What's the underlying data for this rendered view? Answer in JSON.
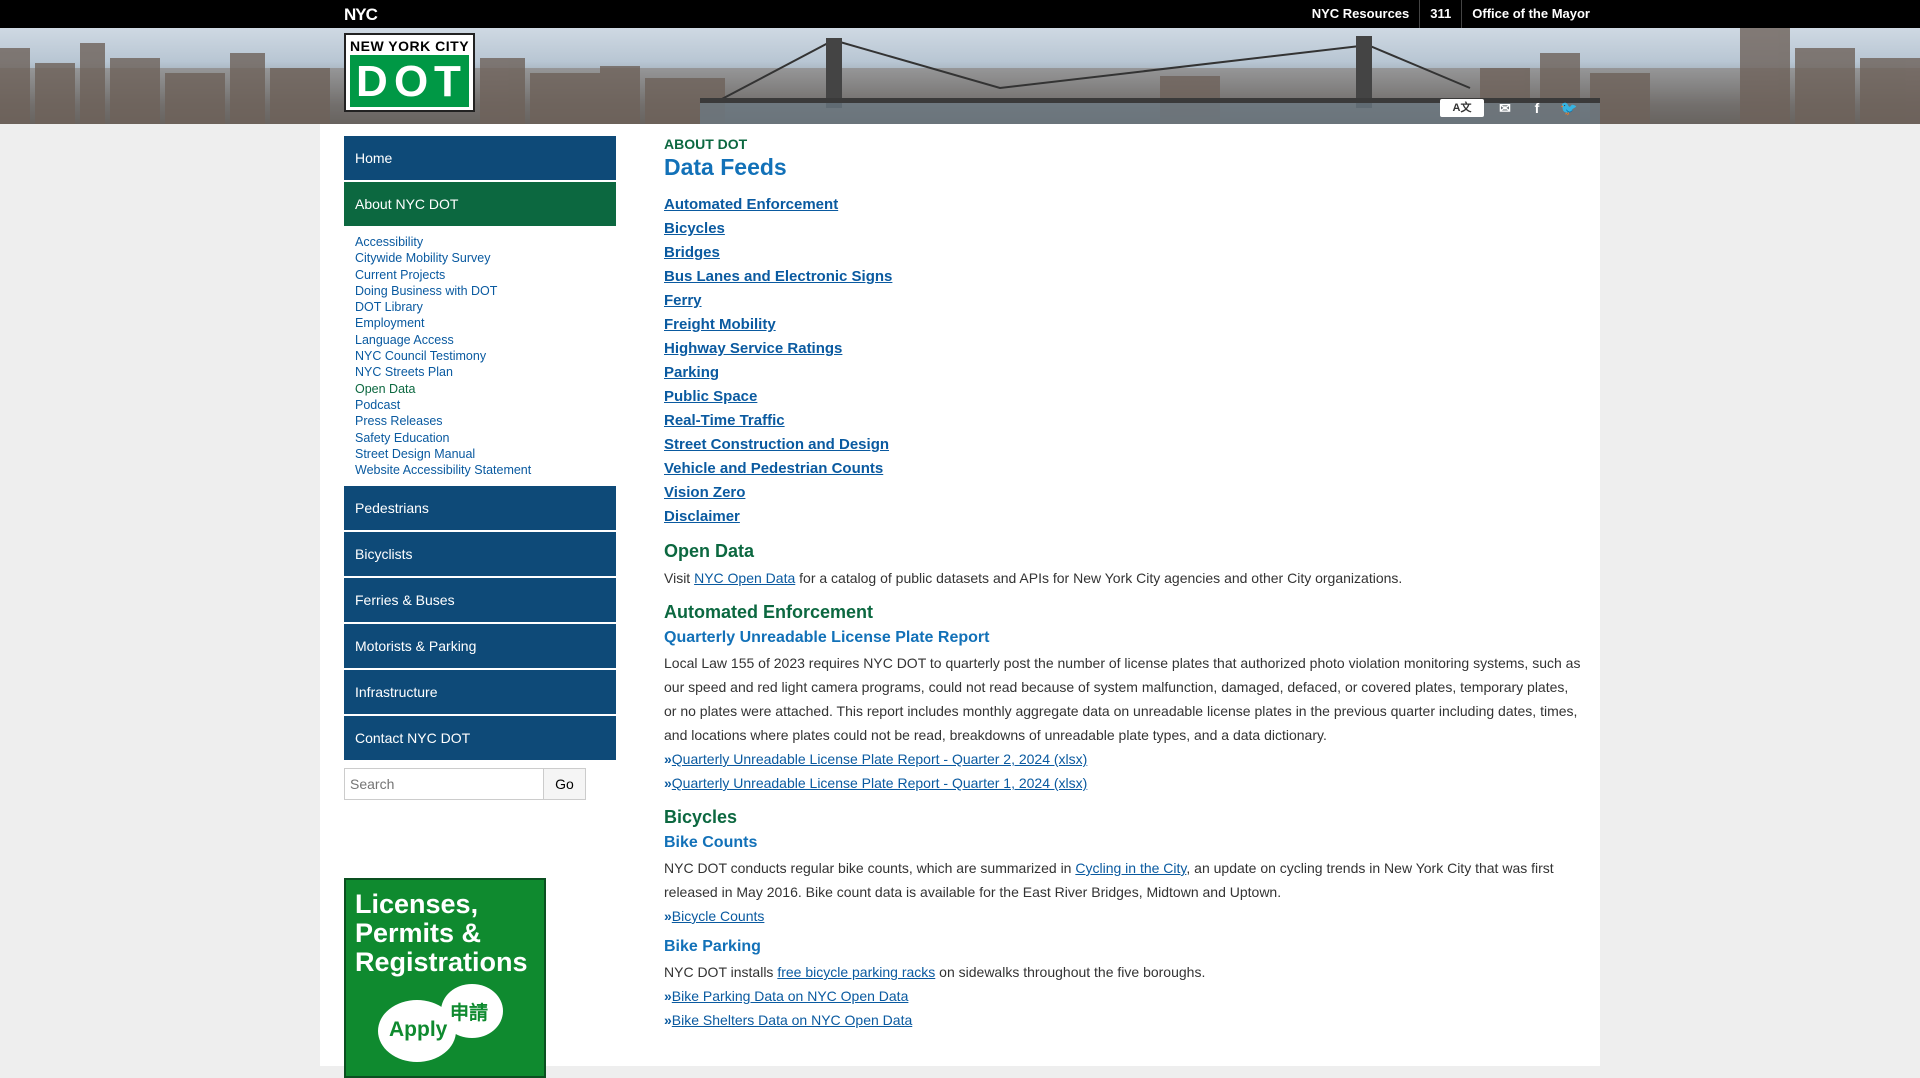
{
  "topbar": {
    "logo": "NYC",
    "links": [
      "NYC Resources",
      "311",
      "Office of the Mayor"
    ]
  },
  "header": {
    "logo_top": "NEW YORK CITY",
    "logo_letters": [
      "D",
      "O",
      "T"
    ]
  },
  "social_icons": [
    "translate-icon",
    "email-icon",
    "facebook-icon",
    "twitter-icon"
  ],
  "sidebar": {
    "nav_top": [
      {
        "label": "Home"
      },
      {
        "label": "About NYC DOT"
      }
    ],
    "subnav": [
      "Accessibility",
      "Citywide Mobility Survey",
      "Current Projects",
      "Doing Business with DOT",
      "DOT Library",
      "Employment",
      "Language Access",
      "NYC Council Testimony",
      "NYC Streets Plan",
      "Open Data",
      "Podcast",
      "Press Releases",
      "Safety Education",
      "Street Design Manual",
      "Website Accessibility Statement"
    ],
    "nav_bottom": [
      {
        "label": "Pedestrians"
      },
      {
        "label": "Bicyclists"
      },
      {
        "label": "Ferries & Buses"
      },
      {
        "label": "Motorists & Parking"
      },
      {
        "label": "Infrastructure"
      },
      {
        "label": "Contact NYC DOT"
      }
    ],
    "search_placeholder": "Search",
    "search_button": "Go",
    "promo": {
      "title_lines": [
        "Licenses,",
        "Permits &",
        "Registrations"
      ],
      "apply": "Apply",
      "apply_cn": "申請"
    }
  },
  "main": {
    "eyebrow": "ABOUT DOT",
    "title": "Data Feeds",
    "feeds": [
      "Automated Enforcement",
      "Bicycles",
      "Bridges",
      "Bus Lanes and Electronic Signs",
      "Ferry",
      "Freight Mobility",
      "Highway Service Ratings",
      "Parking",
      "Public Space",
      "Real-Time Traffic",
      "Street Construction and Design",
      "Vehicle and Pedestrian Counts",
      "Vision Zero",
      "Disclaimer"
    ],
    "open_data": {
      "heading": "Open Data",
      "pre": "Visit ",
      "link": "NYC Open Data",
      "post": " for a catalog of public datasets and APIs for New York City agencies and other City organizations."
    },
    "auto": {
      "heading": "Automated Enforcement",
      "sub": "Quarterly Unreadable License Plate Report",
      "body": "Local Law 155 of 2023 requires NYC DOT to quarterly post the number of license plates that authorized photo violation monitoring systems, such as our speed and red light camera programs, could not read because of system malfunction, damaged, defaced, or covered plates, temporary plates, or no plates were attached. This report includes monthly aggregate data on unreadable license plates in the previous quarter including dates, times, and locations where plates could not be read, breakdowns of unreadable plate types, and a data dictionary.",
      "links": [
        "Quarterly Unreadable License Plate Report - Quarter 2, 2024 (xlsx)",
        "Quarterly Unreadable License Plate Report - Quarter 1, 2024 (xlsx)"
      ]
    },
    "bicycles": {
      "heading": "Bicycles",
      "sub1": "Bike Counts",
      "body1_pre": "NYC DOT conducts regular bike counts, which are summarized in ",
      "body1_link": "Cycling in the City",
      "body1_post": ", an update on cycling trends in New York City that was first released in May 2016. Bike count data is available for the East River Bridges, Midtown and Uptown.",
      "link1": "Bicycle Counts",
      "sub2": "Bike Parking",
      "body2_pre": "NYC DOT installs ",
      "body2_link": "free bicycle parking racks",
      "body2_post": " on sidewalks throughout the five boroughs.",
      "links2": [
        "Bike Parking Data on NYC Open Data",
        "Bike Shelters Data on NYC Open Data"
      ]
    },
    "arrow": "»"
  }
}
